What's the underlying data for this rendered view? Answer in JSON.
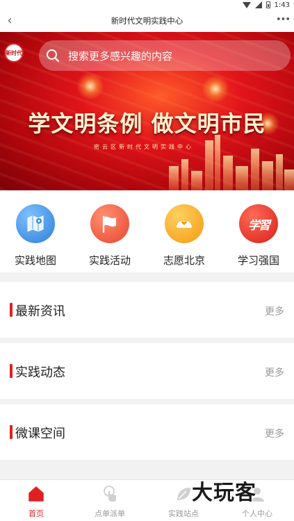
{
  "status": {
    "time": "1:43"
  },
  "header": {
    "title": "新时代文明实践中心"
  },
  "search": {
    "placeholder": "搜索更多感兴趣的内容"
  },
  "banner": {
    "logo_text": "新时代",
    "headline": "学文明条例  做文明市民",
    "subline": "密云区新时代文明实践中心"
  },
  "quick_access": [
    {
      "label": "实践地图",
      "icon": "map-icon",
      "color": "#3d8fe0"
    },
    {
      "label": "实践活动",
      "icon": "flag-icon",
      "color": "#f05a40"
    },
    {
      "label": "志愿北京",
      "icon": "volunteer-heart-icon",
      "color": "#f7a21a"
    },
    {
      "label": "学习强国",
      "icon": "xuexi-icon",
      "color": "#e8302a"
    }
  ],
  "sections": [
    {
      "title": "最新资讯",
      "more": "更多"
    },
    {
      "title": "实践动态",
      "more": "更多"
    },
    {
      "title": "微课空间",
      "more": "更多"
    }
  ],
  "bottom_nav": [
    {
      "label": "首页",
      "icon": "home-icon",
      "active": true
    },
    {
      "label": "点单派单",
      "icon": "tap-order-icon",
      "active": false
    },
    {
      "label": "实践站点",
      "icon": "leaf-site-icon",
      "active": false
    },
    {
      "label": "个人中心",
      "icon": "person-icon",
      "active": false
    }
  ],
  "watermark": "大玩客",
  "colors": {
    "accent": "#e02020",
    "banner_red": "#d8141b"
  }
}
